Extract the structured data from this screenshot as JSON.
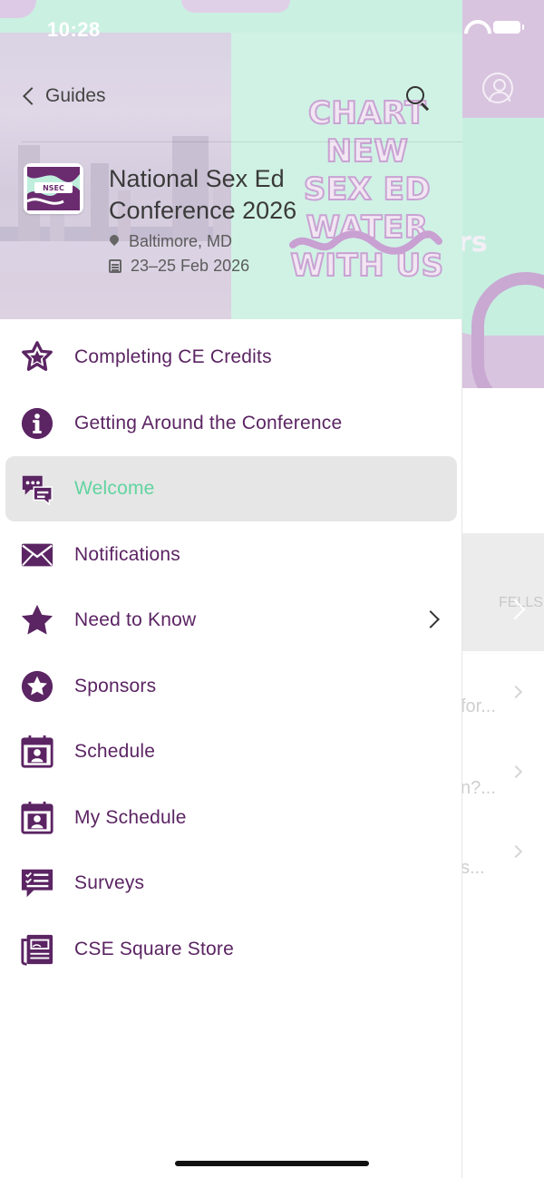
{
  "status_bar": {
    "time": "10:28"
  },
  "header": {
    "back_label": "Guides",
    "slogan_lines": [
      "CHART NEW",
      "SEX ED WATER",
      "WITH US"
    ],
    "logo_text": "NSEC",
    "event_title": "National Sex Ed Conference 2026",
    "location": "Baltimore, MD",
    "dates": "23–25 Feb 2026"
  },
  "menu": {
    "items": [
      {
        "label": "Completing CE Credits",
        "icon": "star-badge-icon",
        "selected": false,
        "has_chevron": false
      },
      {
        "label": "Getting Around the Conference",
        "icon": "info-icon",
        "selected": false,
        "has_chevron": false
      },
      {
        "label": "Welcome",
        "icon": "chat-bubbles-icon",
        "selected": true,
        "has_chevron": false
      },
      {
        "label": "Notifications",
        "icon": "envelope-icon",
        "selected": false,
        "has_chevron": false
      },
      {
        "label": "Need to Know",
        "icon": "star-icon",
        "selected": false,
        "has_chevron": true
      },
      {
        "label": "Sponsors",
        "icon": "star-circle-icon",
        "selected": false,
        "has_chevron": false
      },
      {
        "label": "Schedule",
        "icon": "calendar-person-icon",
        "selected": false,
        "has_chevron": false
      },
      {
        "label": "My Schedule",
        "icon": "calendar-person-icon",
        "selected": false,
        "has_chevron": false
      },
      {
        "label": "Surveys",
        "icon": "survey-chat-icon",
        "selected": false,
        "has_chevron": false
      },
      {
        "label": "CSE Square Store",
        "icon": "store-icon",
        "selected": false,
        "has_chevron": false
      }
    ]
  },
  "background_app": {
    "banner_fragment": "rs",
    "card_text": "FELLS",
    "list_fragments": [
      "for...",
      "n?...",
      "s..."
    ]
  },
  "colors": {
    "menu_text": "#5b2463",
    "selected_text": "#62d4a0",
    "selected_bg": "#e6e6e6",
    "mint": "#c6efe0",
    "lavender": "#d9c4df"
  }
}
